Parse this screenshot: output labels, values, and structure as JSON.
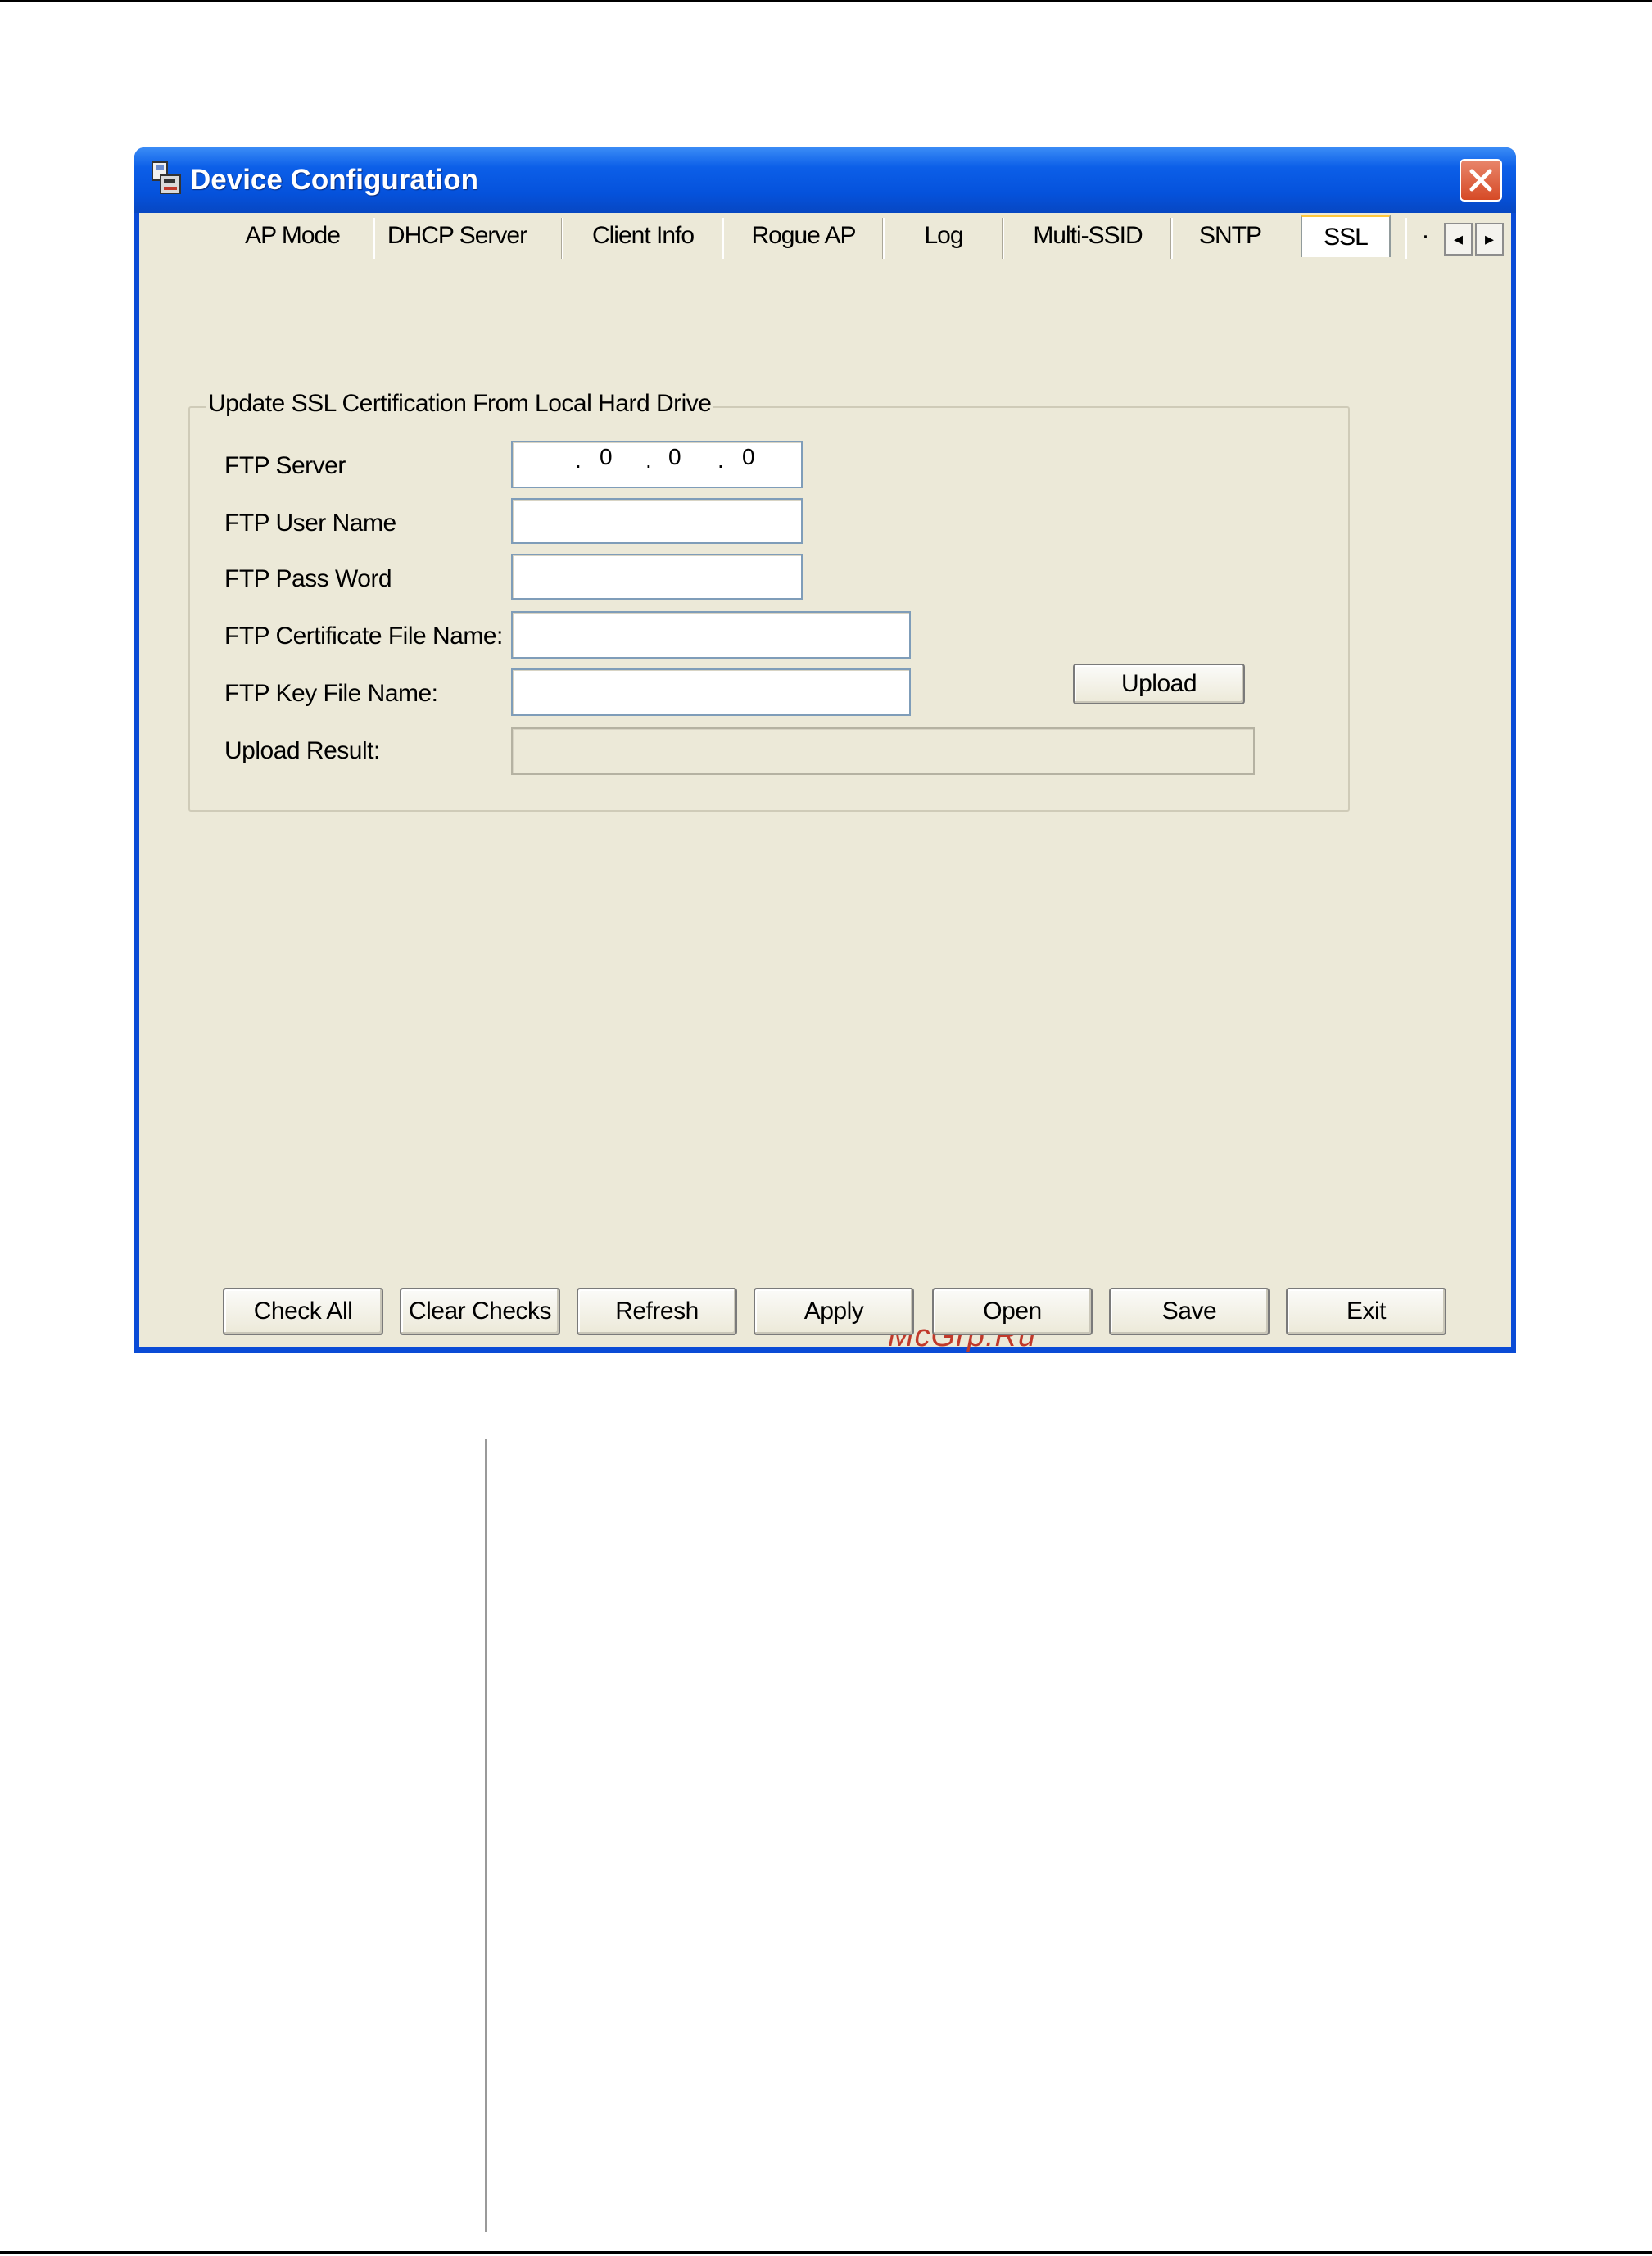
{
  "window": {
    "title": "Device Configuration",
    "close_icon": "close-icon"
  },
  "tabs": [
    {
      "label": "AP Mode"
    },
    {
      "label": "DHCP Server"
    },
    {
      "label": "Client Info"
    },
    {
      "label": "Rogue AP"
    },
    {
      "label": "Log"
    },
    {
      "label": "Multi-SSID"
    },
    {
      "label": "SNTP"
    },
    {
      "label": "SSL",
      "active": true
    },
    {
      "label": "·"
    }
  ],
  "tab_scroll": {
    "left": "◂",
    "right": "▸"
  },
  "ssl_group": {
    "title": "Update SSL Certification From Local Hard Drive",
    "ftp_server_label": "FTP Server",
    "ftp_server_ip": [
      "",
      "0",
      "0",
      "0"
    ],
    "ftp_user_label": "FTP User Name",
    "ftp_user_value": "",
    "ftp_pass_label": "FTP Pass Word",
    "ftp_pass_value": "",
    "cert_file_label": "FTP Certificate File Name:",
    "cert_file_value": "",
    "key_file_label": "FTP Key File Name:",
    "key_file_value": "",
    "upload_button": "Upload",
    "upload_result_label": "Upload Result:",
    "upload_result_value": ""
  },
  "watermark": "McGrp.Ru",
  "footer_buttons": {
    "check_all": "Check All",
    "clear_checks": "Clear Checks",
    "refresh": "Refresh",
    "apply": "Apply",
    "open": "Open",
    "save": "Save",
    "exit": "Exit"
  },
  "colors": {
    "title_bar": "#0552dc",
    "client_bg": "#ece9d8",
    "watermark": "#c0392b"
  }
}
